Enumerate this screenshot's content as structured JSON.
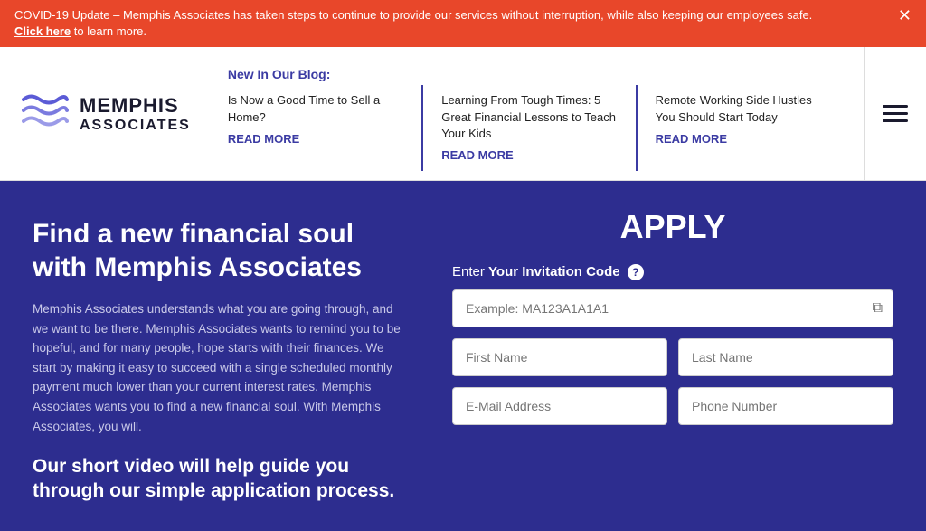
{
  "alert": {
    "text": "COVID-19 Update – Memphis Associates has taken steps to continue to provide our services without interruption, while also keeping our employees safe.",
    "link_text": "Click here",
    "link_suffix": " to learn more.",
    "close_label": "✕"
  },
  "header": {
    "logo": {
      "name1": "MEMPHIS",
      "name2": "ASSOCIATES"
    },
    "blog": {
      "label": "New In Our Blog:",
      "items": [
        {
          "title": "Is Now a Good Time to Sell a Home?",
          "cta": "READ MORE"
        },
        {
          "title": "Learning From Tough Times: 5 Great Financial Lessons to Teach Your Kids",
          "cta": "READ MORE"
        },
        {
          "title": "Remote Working Side Hustles You Should Start Today",
          "cta": "READ MORE"
        }
      ]
    }
  },
  "hero": {
    "headline": "Find a new financial soul with Memphis Associates",
    "body": "Memphis Associates understands what you are going through, and we want to be there. Memphis Associates wants to remind you to be hopeful, and for many people, hope starts with their finances. We start by making it easy to succeed with a single scheduled monthly payment much lower than your current interest rates. Memphis Associates wants you to find a new financial soul. With Memphis Associates, you will.",
    "subheading": "Our short video will help guide you through our simple application process.",
    "apply_title": "APPLY",
    "invitation_label": "Enter",
    "invitation_bold": "Your Invitation Code",
    "invitation_placeholder": "Example: MA123A1A1A1",
    "first_name_placeholder": "First Name",
    "last_name_placeholder": "Last Name",
    "email_placeholder": "E-Mail Address",
    "phone_placeholder": "Phone Number"
  }
}
